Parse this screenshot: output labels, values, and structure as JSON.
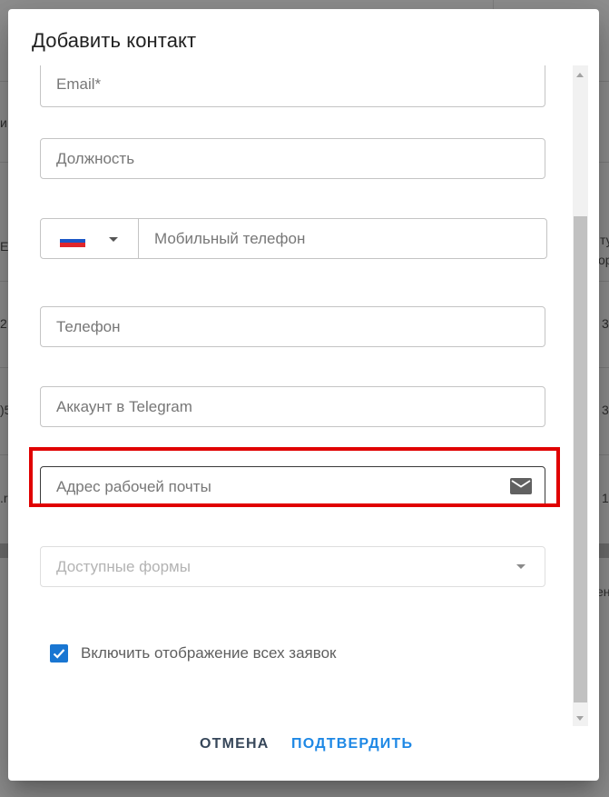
{
  "dialog": {
    "title": "Добавить контакт",
    "fields": {
      "email": {
        "placeholder": "Email*"
      },
      "position": {
        "placeholder": "Должность"
      },
      "mobile": {
        "placeholder": "Мобильный телефон",
        "country_flag": "russia-flag"
      },
      "phone": {
        "placeholder": "Телефон"
      },
      "telegram": {
        "placeholder": "Аккаунт в Telegram"
      },
      "work_email": {
        "placeholder": "Адрес рабочей почты",
        "icon": "mail-icon"
      },
      "forms": {
        "placeholder": "Доступные формы"
      }
    },
    "checkbox": {
      "label": "Включить отображение всех заявок",
      "checked": true
    },
    "actions": {
      "cancel": "ОТМЕНА",
      "confirm": "ПОДТВЕРДИТЬ"
    }
  },
  "colors": {
    "primary": "#1976d2",
    "confirm_text": "#1e88e5",
    "highlight": "#e00000"
  },
  "background": {
    "partial_texts": [
      "и",
      "Er",
      "2",
      ")5",
      ".r",
      "ту",
      "ор",
      "3",
      "3",
      "1",
      "ен"
    ]
  }
}
